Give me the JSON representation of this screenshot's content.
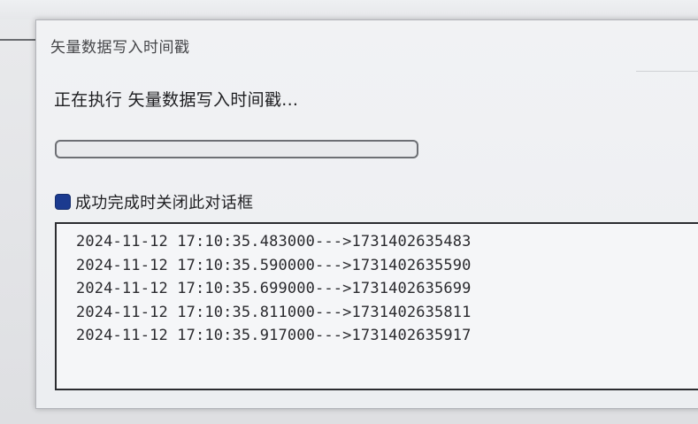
{
  "window": {
    "title": "矢量数据写入时间戳"
  },
  "status": {
    "text": "正在执行 矢量数据写入时间戳..."
  },
  "progress": {
    "value": 0
  },
  "close_on_success": {
    "label": "成功完成时关闭此对话框",
    "checked": true
  },
  "log": {
    "lines": [
      "2024-11-12 17:10:35.483000--->1731402635483",
      "2024-11-12 17:10:35.590000--->1731402635590",
      "2024-11-12 17:10:35.699000--->1731402635699",
      "2024-11-12 17:10:35.811000--->1731402635811",
      "2024-11-12 17:10:35.917000--->1731402635917"
    ]
  },
  "colors": {
    "checkbox": "#1b3a8f",
    "progress_border": "#6d6f74",
    "log_border": "#2b2c30"
  }
}
